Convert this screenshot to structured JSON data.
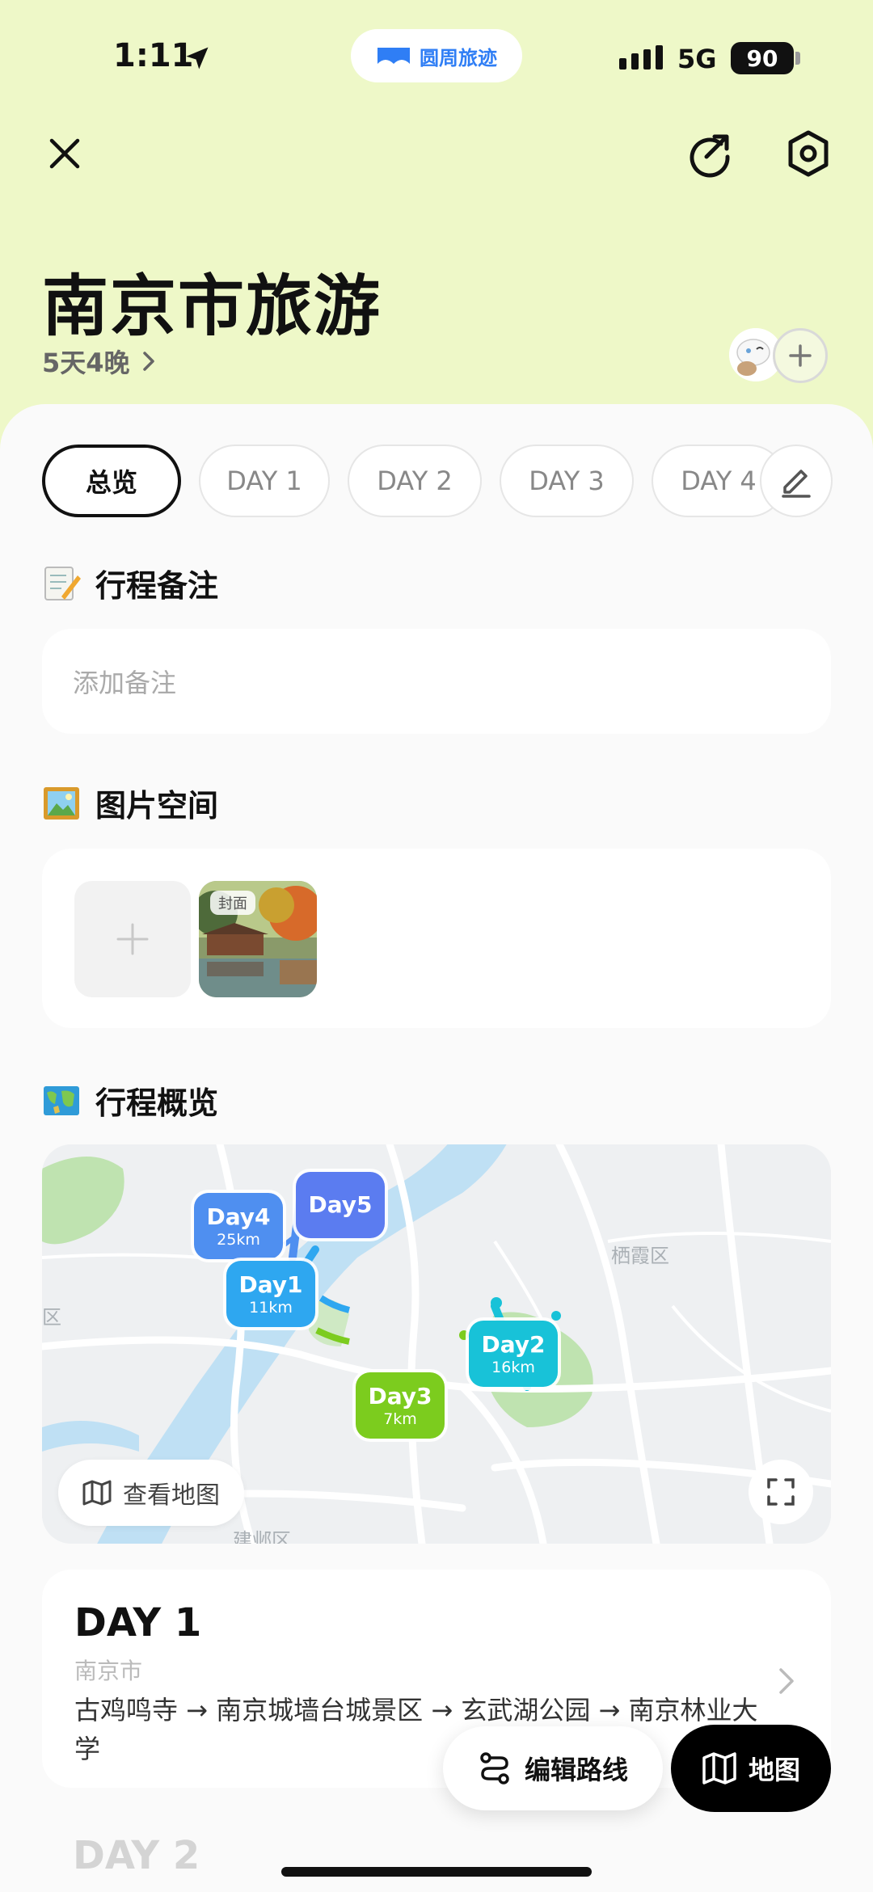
{
  "status_bar": {
    "time": "1:11",
    "app_pill_label": "圆周旅迹",
    "network": "5G",
    "battery": "90"
  },
  "header": {
    "title": "南京市旅游",
    "duration": "5天4晚",
    "close_icon": "close-icon",
    "share_icon": "share-icon",
    "settings_icon": "settings-icon"
  },
  "tabs": [
    {
      "label": "总览",
      "active": true
    },
    {
      "label": "DAY 1",
      "active": false
    },
    {
      "label": "DAY 2",
      "active": false
    },
    {
      "label": "DAY 3",
      "active": false
    },
    {
      "label": "DAY 4",
      "active": false
    }
  ],
  "notes": {
    "title": "行程备注",
    "placeholder": "添加备注"
  },
  "photos": {
    "title": "图片空间",
    "cover_tag": "封面"
  },
  "overview": {
    "title": "行程概览",
    "view_map_label": "查看地图",
    "map_labels": [
      "栖霞区",
      "建邺区",
      "区"
    ],
    "markers": [
      {
        "name": "Day4",
        "distance": "25km",
        "color": "#4f8ff0"
      },
      {
        "name": "Day5",
        "distance": "",
        "color": "#5b7cf0"
      },
      {
        "name": "Day1",
        "distance": "11km",
        "color": "#2ea7f0"
      },
      {
        "name": "Day2",
        "distance": "16km",
        "color": "#18c2d8"
      },
      {
        "name": "Day3",
        "distance": "7km",
        "color": "#7ccc1e"
      }
    ]
  },
  "day_card": {
    "title": "DAY 1",
    "city": "南京市",
    "route": "古鸡鸣寺 → 南京城墙台城景区 → 玄武湖公园 → 南京林业大学"
  },
  "next_day_title": "DAY 2",
  "actions": {
    "edit_route_label": "编辑路线",
    "map_label": "地图"
  },
  "colors": {
    "header_bg": "#eef8c8",
    "accent_blue": "#2f7ef5",
    "primary_dark": "#000000"
  }
}
